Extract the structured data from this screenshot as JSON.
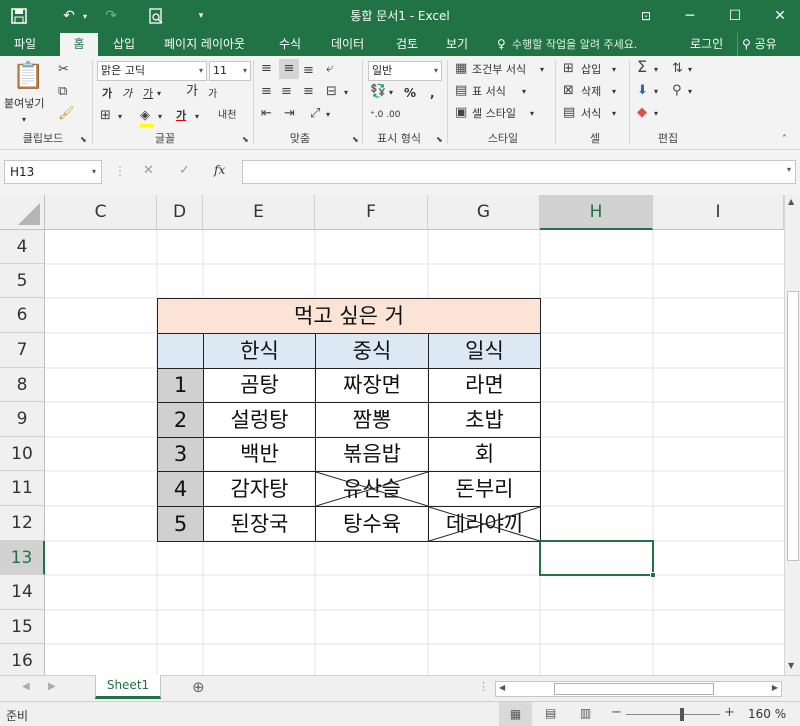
{
  "title_bar": {
    "title": "통합 문서1 - Excel",
    "save_icon": "save-icon",
    "undo_icon": "undo-icon",
    "redo_icon": "redo-icon",
    "preview_icon": "print-preview-icon",
    "qat_icon": "customize-qat-icon",
    "ribbon_display_icon": "ribbon-display-options-icon",
    "min_label": "─",
    "max_label": "☐",
    "close_label": "✕"
  },
  "menu": {
    "file": "파일",
    "tabs": [
      "홈",
      "삽입",
      "페이지 레이아웃",
      "수식",
      "데이터",
      "검토",
      "보기"
    ],
    "active_tab": "홈",
    "tell_me": "수행할 작업을 알려 주세요.",
    "login": "로그인",
    "share": "공유"
  },
  "ribbon": {
    "clipboard": {
      "label": "클립보드",
      "paste": "붙여넣기"
    },
    "font": {
      "label": "글꼴",
      "font_name": "맑은 고딕",
      "font_size": "11",
      "bold": "가",
      "italic": "가",
      "underline": "가",
      "grow": "가",
      "shrink": "가",
      "phonetic": "내천"
    },
    "align": {
      "label": "맞춤"
    },
    "number": {
      "label": "표시 형식",
      "format": "일반",
      "percent": "%",
      "comma": ","
    },
    "styles": {
      "label": "스타일",
      "cond": "조건부 서식",
      "table": "표 서식",
      "cell": "셀 스타일"
    },
    "cells": {
      "label": "셀",
      "insert": "삽입",
      "delete": "삭제",
      "format": "서식"
    },
    "editing": {
      "label": "편집"
    }
  },
  "formula_bar": {
    "name_box": "H13",
    "cancel": "✕",
    "enter": "✓",
    "fx": "fx",
    "value": ""
  },
  "columns": [
    "C",
    "D",
    "E",
    "F",
    "G",
    "H",
    "I"
  ],
  "selected_column": "H",
  "rows": [
    "4",
    "5",
    "6",
    "7",
    "8",
    "9",
    "10",
    "11",
    "12",
    "13",
    "14",
    "15",
    "16"
  ],
  "selected_row": "13",
  "table": {
    "title": "먹고 싶은 거",
    "headers": [
      "한식",
      "중식",
      "일식"
    ],
    "rows": [
      {
        "n": "1",
        "cells": [
          "곰탕",
          "짜장면",
          "라면"
        ],
        "crossed": [
          false,
          false,
          false
        ]
      },
      {
        "n": "2",
        "cells": [
          "설렁탕",
          "짬뽕",
          "초밥"
        ],
        "crossed": [
          false,
          false,
          false
        ]
      },
      {
        "n": "3",
        "cells": [
          "백반",
          "볶음밥",
          "회"
        ],
        "crossed": [
          false,
          false,
          false
        ]
      },
      {
        "n": "4",
        "cells": [
          "감자탕",
          "유산슬",
          "돈부리"
        ],
        "crossed": [
          false,
          true,
          false
        ]
      },
      {
        "n": "5",
        "cells": [
          "된장국",
          "탕수육",
          "데리야끼"
        ],
        "crossed": [
          false,
          false,
          true
        ]
      }
    ]
  },
  "sheets": {
    "tabs": [
      "Sheet1"
    ],
    "active": "Sheet1",
    "add_label": "⊕"
  },
  "status": {
    "text": "준비",
    "zoom": "160 %",
    "zoom_level": 0.6
  }
}
